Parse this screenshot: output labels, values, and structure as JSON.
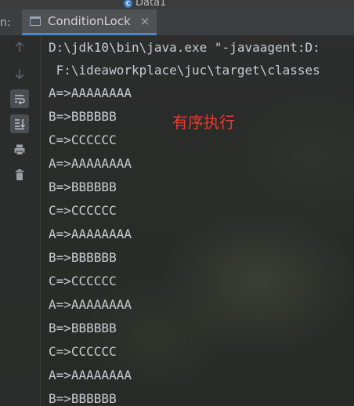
{
  "window": {
    "top_file_label": "Data1",
    "top_file_badge": "C",
    "run_prefix": "n:",
    "tab_label": "ConditionLock",
    "tab_close": "×"
  },
  "gutter": {
    "buttons": [
      {
        "icon": "arrow-up-icon",
        "glyph": "↑",
        "state": "disabled"
      },
      {
        "icon": "arrow-down-icon",
        "glyph": "↓",
        "state": "disabled"
      },
      {
        "icon": "soft-wrap-icon",
        "glyph": "⤶",
        "state": "active"
      },
      {
        "icon": "scroll-to-end-icon",
        "glyph": "⤓",
        "state": "active"
      },
      {
        "icon": "print-icon",
        "glyph": "⎙",
        "state": "normal"
      },
      {
        "icon": "trash-icon",
        "glyph": "🗑",
        "state": "normal"
      }
    ]
  },
  "console": {
    "command_line_1": "D:\\jdk10\\bin\\java.exe \"-javaagent:D:",
    "command_line_2": " F:\\ideaworkplace\\juc\\target\\classes",
    "output_lines": [
      "A=>AAAAAAAA",
      "B=>BBBBBB",
      "C=>CCCCCC",
      "A=>AAAAAAAA",
      "B=>BBBBBB",
      "C=>CCCCCC",
      "A=>AAAAAAAA",
      "B=>BBBBBB",
      "C=>CCCCCC",
      "A=>AAAAAAAA",
      "B=>BBBBBB",
      "C=>CCCCCC",
      "A=>AAAAAAAA",
      "B=>BBBBBB"
    ],
    "annotation": "有序执行",
    "annotation_color": "#e83a2f"
  },
  "colors": {
    "tab_accent": "#4a88c7",
    "console_text": "#c9ccd1",
    "background": "#2b2b2b"
  }
}
